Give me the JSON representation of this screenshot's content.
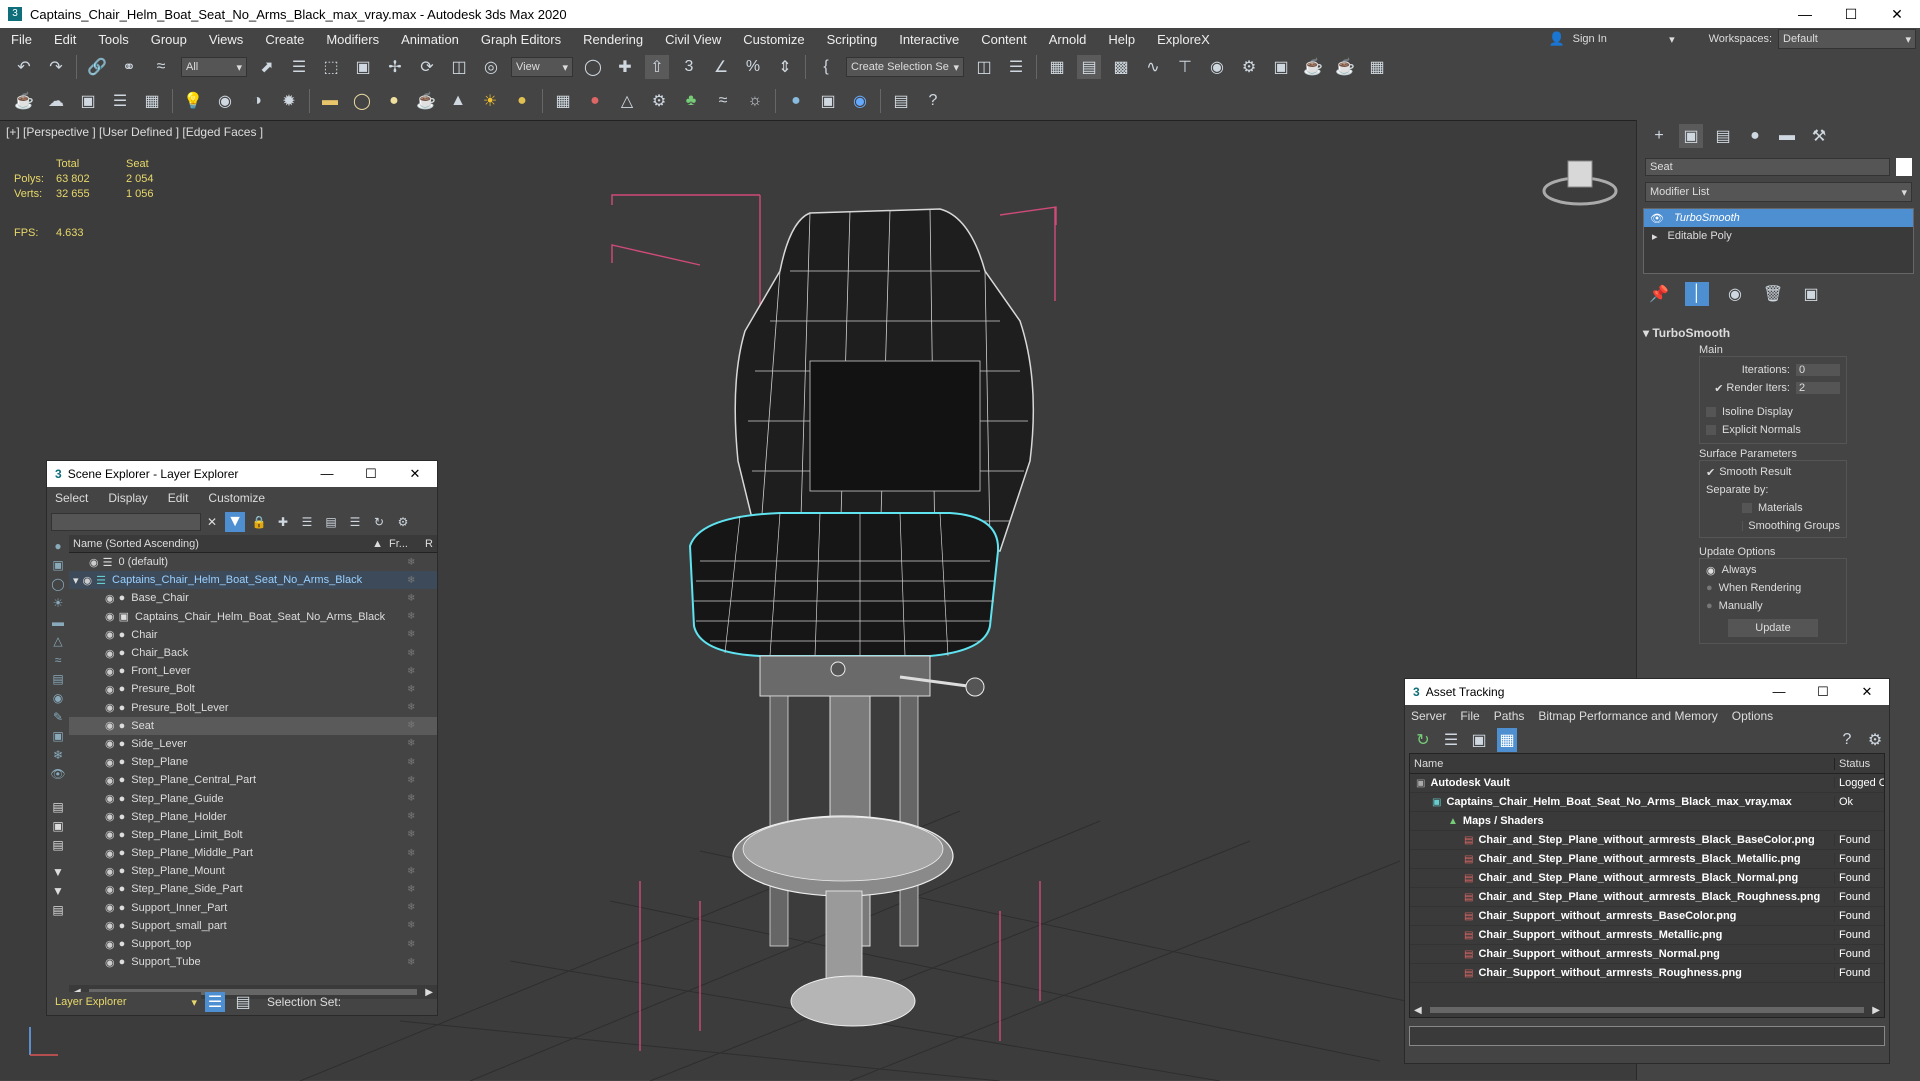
{
  "window": {
    "title": "Captains_Chair_Helm_Boat_Seat_No_Arms_Black_max_vray.max - Autodesk 3ds Max 2020",
    "app_badge": "3"
  },
  "menu": {
    "items": [
      "File",
      "Edit",
      "Tools",
      "Group",
      "Views",
      "Create",
      "Modifiers",
      "Animation",
      "Graph Editors",
      "Rendering",
      "Civil View",
      "Customize",
      "Scripting",
      "Interactive",
      "Content",
      "Arnold",
      "Help",
      "ExploreX"
    ],
    "sign_in": "Sign In",
    "workspaces_label": "Workspaces:",
    "workspace_value": "Default"
  },
  "toolbar": {
    "filter_value": "All",
    "view_value": "View",
    "selection_set": "Create Selection Se"
  },
  "viewport": {
    "label": "[+] [Perspective ] [User Defined ] [Edged Faces ]",
    "stats": {
      "total_label": "Total",
      "seat_label": "Seat",
      "polys_label": "Polys:",
      "polys_total": "63 802",
      "polys_seat": "2 054",
      "verts_label": "Verts:",
      "verts_total": "32 655",
      "verts_seat": "1 056",
      "fps_label": "FPS:",
      "fps_value": "4.633"
    }
  },
  "command_panel": {
    "object_name": "Seat",
    "modifier_list": "Modifier List",
    "stack": [
      "TurboSmooth",
      "Editable Poly"
    ],
    "rollout_title": "TurboSmooth",
    "main_label": "Main",
    "iterations_label": "Iterations:",
    "iterations_value": "0",
    "render_iters_label": "Render Iters:",
    "render_iters_value": "2",
    "isoline_label": "Isoline Display",
    "explicit_normals_label": "Explicit Normals",
    "surface_params_label": "Surface Parameters",
    "smooth_result_label": "Smooth Result",
    "separate_by_label": "Separate by:",
    "materials_label": "Materials",
    "smoothing_groups_label": "Smoothing Groups",
    "update_options_label": "Update Options",
    "always_label": "Always",
    "when_rendering_label": "When Rendering",
    "manually_label": "Manually",
    "update_button": "Update"
  },
  "scene_explorer": {
    "title": "Scene Explorer - Layer Explorer",
    "menu": [
      "Select",
      "Display",
      "Edit",
      "Customize"
    ],
    "col_name": "Name (Sorted Ascending)",
    "col_fr": "Fr...",
    "col_r": "R",
    "items": [
      {
        "label": "0 (default)",
        "indent": 0
      },
      {
        "label": "Captains_Chair_Helm_Boat_Seat_No_Arms_Black",
        "indent": 0
      },
      {
        "label": "Base_Chair",
        "indent": 1
      },
      {
        "label": "Captains_Chair_Helm_Boat_Seat_No_Arms_Black",
        "indent": 1
      },
      {
        "label": "Chair",
        "indent": 1
      },
      {
        "label": "Chair_Back",
        "indent": 1
      },
      {
        "label": "Front_Lever",
        "indent": 1
      },
      {
        "label": "Presure_Bolt",
        "indent": 1
      },
      {
        "label": "Presure_Bolt_Lever",
        "indent": 1
      },
      {
        "label": "Seat",
        "indent": 1
      },
      {
        "label": "Side_Lever",
        "indent": 1
      },
      {
        "label": "Step_Plane",
        "indent": 1
      },
      {
        "label": "Step_Plane_Central_Part",
        "indent": 1
      },
      {
        "label": "Step_Plane_Guide",
        "indent": 1
      },
      {
        "label": "Step_Plane_Holder",
        "indent": 1
      },
      {
        "label": "Step_Plane_Limit_Bolt",
        "indent": 1
      },
      {
        "label": "Step_Plane_Middle_Part",
        "indent": 1
      },
      {
        "label": "Step_Plane_Mount",
        "indent": 1
      },
      {
        "label": "Step_Plane_Side_Part",
        "indent": 1
      },
      {
        "label": "Support_Inner_Part",
        "indent": 1
      },
      {
        "label": "Support_small_part",
        "indent": 1
      },
      {
        "label": "Support_top",
        "indent": 1
      },
      {
        "label": "Support_Tube",
        "indent": 1
      }
    ],
    "footer_explorer": "Layer Explorer",
    "footer_selection": "Selection Set:"
  },
  "asset_tracking": {
    "title": "Asset Tracking",
    "menu": [
      "Server",
      "File",
      "Paths",
      "Bitmap Performance and Memory",
      "Options"
    ],
    "col_name": "Name",
    "col_status": "Status",
    "rows": [
      {
        "name": "Autodesk Vault",
        "status": "Logged O",
        "indent": 0
      },
      {
        "name": "Captains_Chair_Helm_Boat_Seat_No_Arms_Black_max_vray.max",
        "status": "Ok",
        "indent": 1
      },
      {
        "name": "Maps / Shaders",
        "status": "",
        "indent": 2
      },
      {
        "name": "Chair_and_Step_Plane_without_armrests_Black_BaseColor.png",
        "status": "Found",
        "indent": 3
      },
      {
        "name": "Chair_and_Step_Plane_without_armrests_Black_Metallic.png",
        "status": "Found",
        "indent": 3
      },
      {
        "name": "Chair_and_Step_Plane_without_armrests_Black_Normal.png",
        "status": "Found",
        "indent": 3
      },
      {
        "name": "Chair_and_Step_Plane_without_armrests_Black_Roughness.png",
        "status": "Found",
        "indent": 3
      },
      {
        "name": "Chair_Support_without_armrests_BaseColor.png",
        "status": "Found",
        "indent": 3
      },
      {
        "name": "Chair_Support_without_armrests_Metallic.png",
        "status": "Found",
        "indent": 3
      },
      {
        "name": "Chair_Support_without_armrests_Normal.png",
        "status": "Found",
        "indent": 3
      },
      {
        "name": "Chair_Support_without_armrests_Roughness.png",
        "status": "Found",
        "indent": 3
      }
    ]
  },
  "colors": {
    "selection_cyan": "#5fe3f0",
    "bbox_pink": "#d04a7a",
    "active_blue": "#4d8fd1"
  }
}
